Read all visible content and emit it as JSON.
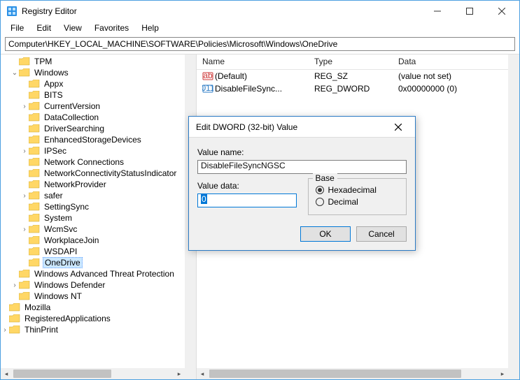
{
  "window": {
    "title": "Registry Editor"
  },
  "menus": {
    "file": "File",
    "edit": "Edit",
    "view": "View",
    "favorites": "Favorites",
    "help": "Help"
  },
  "address": "Computer\\HKEY_LOCAL_MACHINE\\SOFTWARE\\Policies\\Microsoft\\Windows\\OneDrive",
  "tree": [
    {
      "depth": 6,
      "caret": "",
      "label": "TPM"
    },
    {
      "depth": 6,
      "caret": "v",
      "label": "Windows"
    },
    {
      "depth": 7,
      "caret": "",
      "label": "Appx"
    },
    {
      "depth": 7,
      "caret": "",
      "label": "BITS"
    },
    {
      "depth": 7,
      "caret": ">",
      "label": "CurrentVersion"
    },
    {
      "depth": 7,
      "caret": "",
      "label": "DataCollection"
    },
    {
      "depth": 7,
      "caret": "",
      "label": "DriverSearching"
    },
    {
      "depth": 7,
      "caret": "",
      "label": "EnhancedStorageDevices"
    },
    {
      "depth": 7,
      "caret": ">",
      "label": "IPSec"
    },
    {
      "depth": 7,
      "caret": "",
      "label": "Network Connections"
    },
    {
      "depth": 7,
      "caret": "",
      "label": "NetworkConnectivityStatusIndicator"
    },
    {
      "depth": 7,
      "caret": "",
      "label": "NetworkProvider"
    },
    {
      "depth": 7,
      "caret": ">",
      "label": "safer"
    },
    {
      "depth": 7,
      "caret": "",
      "label": "SettingSync"
    },
    {
      "depth": 7,
      "caret": "",
      "label": "System"
    },
    {
      "depth": 7,
      "caret": ">",
      "label": "WcmSvc"
    },
    {
      "depth": 7,
      "caret": "",
      "label": "WorkplaceJoin"
    },
    {
      "depth": 7,
      "caret": "",
      "label": "WSDAPI"
    },
    {
      "depth": 7,
      "caret": "",
      "label": "OneDrive",
      "selected": true
    },
    {
      "depth": 6,
      "caret": "",
      "label": "Windows Advanced Threat Protection"
    },
    {
      "depth": 6,
      "caret": ">",
      "label": "Windows Defender"
    },
    {
      "depth": 6,
      "caret": "",
      "label": "Windows NT"
    },
    {
      "depth": 5,
      "caret": "",
      "label": "Mozilla"
    },
    {
      "depth": 4,
      "caret": "",
      "label": "RegisteredApplications"
    },
    {
      "depth": 4,
      "caret": ">",
      "label": "ThinPrint"
    }
  ],
  "list": {
    "headers": {
      "name": "Name",
      "type": "Type",
      "data": "Data"
    },
    "rows": [
      {
        "icon": "sz",
        "name": "(Default)",
        "type": "REG_SZ",
        "data": "(value not set)"
      },
      {
        "icon": "dw",
        "name": "DisableFileSync...",
        "type": "REG_DWORD",
        "data": "0x00000000 (0)"
      }
    ]
  },
  "dialog": {
    "title": "Edit DWORD (32-bit) Value",
    "value_name_label": "Value name:",
    "value_name": "DisableFileSyncNGSC",
    "value_data_label": "Value data:",
    "value_data": "0",
    "base_label": "Base",
    "hex_label": "Hexadecimal",
    "dec_label": "Decimal",
    "ok": "OK",
    "cancel": "Cancel"
  }
}
